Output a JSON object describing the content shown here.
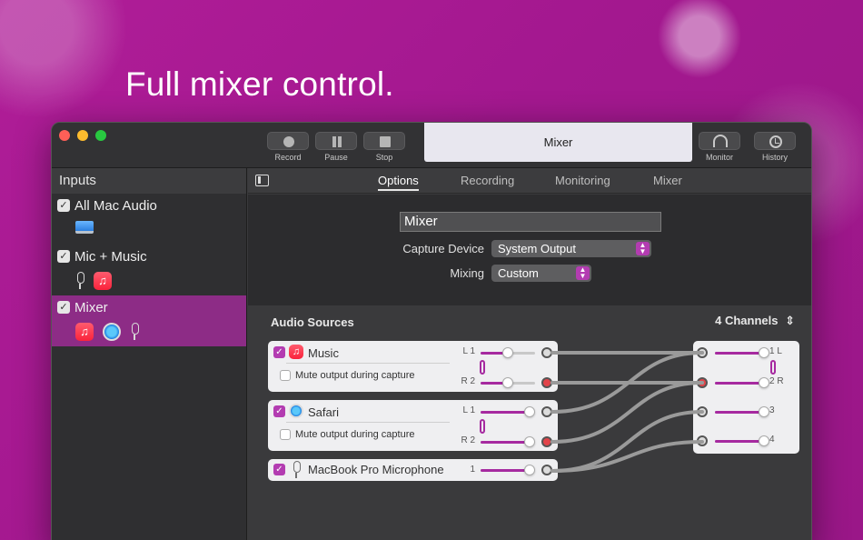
{
  "headline": "Full mixer control.",
  "toolbar": {
    "record": "Record",
    "pause": "Pause",
    "stop": "Stop",
    "title": "Mixer",
    "monitor": "Monitor",
    "history": "History"
  },
  "sidebar": {
    "header": "Inputs",
    "items": [
      {
        "label": "All Mac Audio",
        "icons": [
          "mac-icon"
        ]
      },
      {
        "label": "Mic + Music",
        "icons": [
          "mic-icon",
          "music-icon"
        ]
      },
      {
        "label": "Mixer",
        "icons": [
          "music-icon",
          "safari-icon",
          "mic-icon"
        ]
      }
    ]
  },
  "tabs": [
    "Options",
    "Recording",
    "Monitoring",
    "Mixer"
  ],
  "options": {
    "name_value": "Mixer",
    "capture_device_label": "Capture Device",
    "capture_device_value": "System Output",
    "mixing_label": "Mixing",
    "mixing_value": "Custom"
  },
  "sources": {
    "title": "Audio Sources",
    "channels": "4 Channels",
    "cards": [
      {
        "name": "Music",
        "mute": "Mute output during capture",
        "left": "L 1",
        "right": "R 2"
      },
      {
        "name": "Safari",
        "mute": "Mute output during capture",
        "left": "L 1",
        "right": "R 2"
      },
      {
        "name": "MacBook Pro Microphone",
        "channel": "1"
      }
    ],
    "outputs": [
      "1 L",
      "2 R",
      "3",
      "4"
    ]
  },
  "colors": {
    "accent": "#a62aa0",
    "background": "#a3188f"
  }
}
